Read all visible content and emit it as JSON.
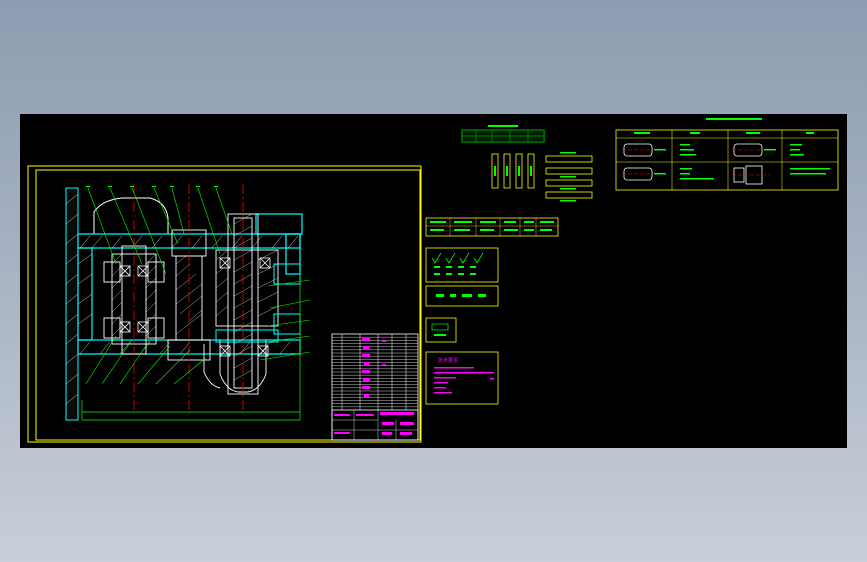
{
  "viewer": {
    "background_color": "#000000",
    "desktop_gradient": [
      "#8d9cb0",
      "#c9cfd8"
    ]
  },
  "colors": {
    "frame": "#ffff00",
    "outline": "#00ff00",
    "section_line": "#00ffff",
    "center_line": "#ff0000",
    "hatch": "#ffffff",
    "annotation": "#ff00ff",
    "detail_text": "#00ff00"
  },
  "drawing": {
    "title": "",
    "notes_heading": "技术要求",
    "title_block_text": "",
    "parts_table_rows": 24
  },
  "icons": {
    "balloon": "leader-balloon-icon",
    "section_view": "section-view-icon",
    "roughness": "surface-roughness-icon"
  }
}
